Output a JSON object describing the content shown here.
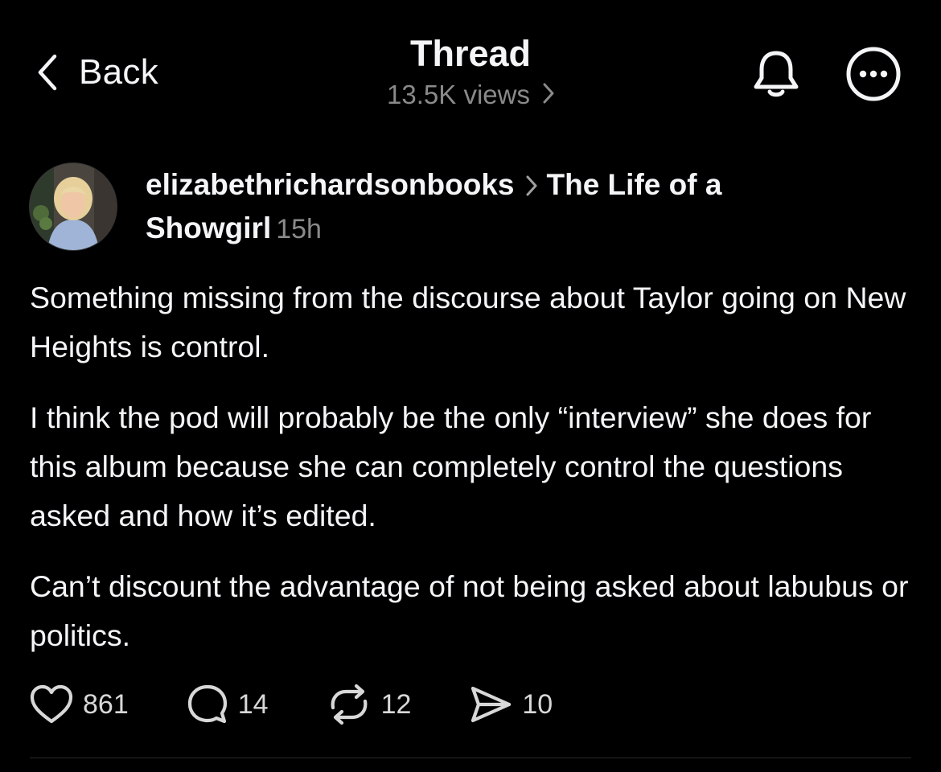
{
  "header": {
    "back_label": "Back",
    "title": "Thread",
    "views": "13.5K views",
    "icons": [
      "chevron-left-icon",
      "chevron-right-icon",
      "bell-icon",
      "more-icon"
    ]
  },
  "post": {
    "username": "elizabethrichardsonbooks",
    "topic": "The Life of a Showgirl",
    "time": "15h",
    "paragraphs": [
      "Something missing from the discourse about Taylor going on New Heights is control.",
      "I think the pod will probably be the only “interview” she does for this album because she can completely control the questions asked and how it’s edited.",
      "Can’t discount the advantage of not being asked about labubus or politics."
    ],
    "actions": {
      "likes": "861",
      "replies": "14",
      "reposts": "12",
      "shares": "10",
      "icons": [
        "heart-icon",
        "comment-icon",
        "repost-icon",
        "send-icon"
      ]
    }
  },
  "colors": {
    "background": "#000000",
    "text": "#f3f5f7",
    "muted": "#8a8a8a",
    "divider": "#2a2a2a"
  }
}
